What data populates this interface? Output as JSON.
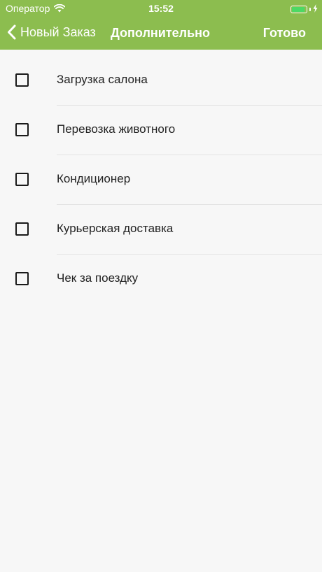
{
  "status_bar": {
    "carrier": "Оператор",
    "time": "15:52",
    "battery_level": 0.9,
    "battery_color": "#4cd964"
  },
  "nav": {
    "back_label": "Новый Заказ",
    "title": "Дополнительно",
    "done_label": "Готово",
    "bar_color": "#8cbd4f"
  },
  "options": [
    {
      "label": "Загрузка салона",
      "checked": false
    },
    {
      "label": "Перевозка животного",
      "checked": false
    },
    {
      "label": "Кондиционер",
      "checked": false
    },
    {
      "label": "Курьерская доставка",
      "checked": false
    },
    {
      "label": "Чек за поездку",
      "checked": false
    }
  ]
}
